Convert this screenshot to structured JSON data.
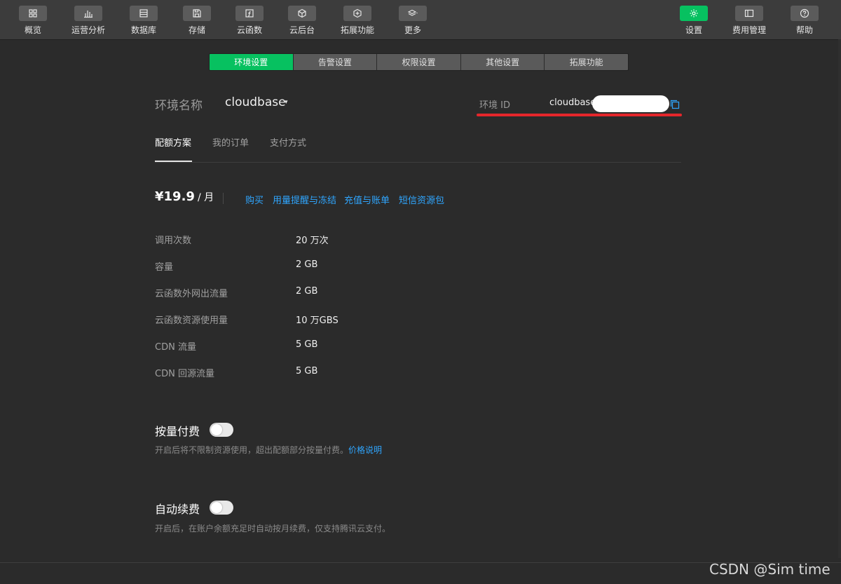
{
  "toolbar": {
    "left_items": [
      {
        "label": "概览",
        "icon": "grid-icon"
      },
      {
        "label": "运营分析",
        "icon": "bar-chart-icon"
      },
      {
        "label": "数据库",
        "icon": "database-icon"
      },
      {
        "label": "存储",
        "icon": "save-icon"
      },
      {
        "label": "云函数",
        "icon": "function-icon"
      },
      {
        "label": "云后台",
        "icon": "cube-icon"
      },
      {
        "label": "拓展功能",
        "icon": "extension-icon"
      },
      {
        "label": "更多",
        "icon": "layers-icon"
      }
    ],
    "right_items": [
      {
        "label": "设置",
        "icon": "gear-icon",
        "active": true
      },
      {
        "label": "费用管理",
        "icon": "billing-icon"
      },
      {
        "label": "帮助",
        "icon": "help-icon"
      }
    ]
  },
  "settings_tabs": [
    "环境设置",
    "告警设置",
    "权限设置",
    "其他设置",
    "拓展功能"
  ],
  "env": {
    "name_label": "环境名称",
    "name_value": "cloudbase",
    "caret": "▾",
    "id_label": "环境 ID",
    "id_value": "cloudbase-"
  },
  "subtabs": [
    "配额方案",
    "我的订单",
    "支付方式"
  ],
  "plan": {
    "price": "¥19.9",
    "period": "/ 月",
    "links": [
      "购买",
      "用量提醒与冻结",
      "充值与账单",
      "短信资源包"
    ]
  },
  "quota": [
    {
      "label": "调用次数",
      "value": "20 万次"
    },
    {
      "label": "容量",
      "value": "2 GB"
    },
    {
      "label": "云函数外网出流量",
      "value": "2 GB"
    },
    {
      "label": "云函数资源使用量",
      "value": "10 万GBS"
    },
    {
      "label": "CDN 流量",
      "value": "5 GB"
    },
    {
      "label": "CDN 回源流量",
      "value": "5 GB"
    }
  ],
  "pay_per_use": {
    "title": "按量付费",
    "desc": "开启后将不限制资源使用，超出配额部分按量付费。",
    "link": "价格说明"
  },
  "auto_renew": {
    "title": "自动续费",
    "desc": "开启后，在账户余额充足时自动按月续费，仅支持腾讯云支付。"
  },
  "watermark": "CSDN @Sim time",
  "colors": {
    "accent": "#07c160",
    "link": "#2fa6ff",
    "annotation": "#e5262b"
  }
}
